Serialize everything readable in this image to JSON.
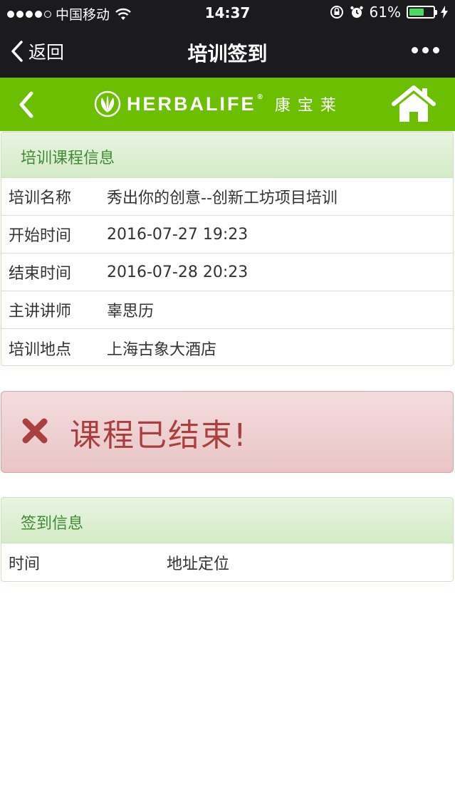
{
  "status_bar": {
    "carrier": "中国移动",
    "time": "14:37",
    "battery": "61%",
    "battery_level": 0.61
  },
  "nav": {
    "back_label": "返回",
    "title": "培训签到",
    "more_icon": "more-icon"
  },
  "brand": {
    "name": "HERBALIFE",
    "reg": "®",
    "cn_name": "康宝莱",
    "color": "#6cbe00"
  },
  "course_info": {
    "header": "培训课程信息",
    "rows": [
      {
        "label": "培训名称",
        "value": "秀出你的创意--创新工坊项目培训"
      },
      {
        "label": "开始时间",
        "value": "2016-07-27 19:23"
      },
      {
        "label": "结束时间",
        "value": "2016-07-28 20:23"
      },
      {
        "label": "主讲讲师",
        "value": "辜思历"
      },
      {
        "label": "培训地点",
        "value": "上海古象大酒店"
      }
    ]
  },
  "alert": {
    "icon": "close-icon",
    "text": "课程已结束!",
    "color": "#a9403f"
  },
  "sign_info": {
    "header": "签到信息",
    "columns": [
      "时间",
      "地址定位"
    ]
  }
}
